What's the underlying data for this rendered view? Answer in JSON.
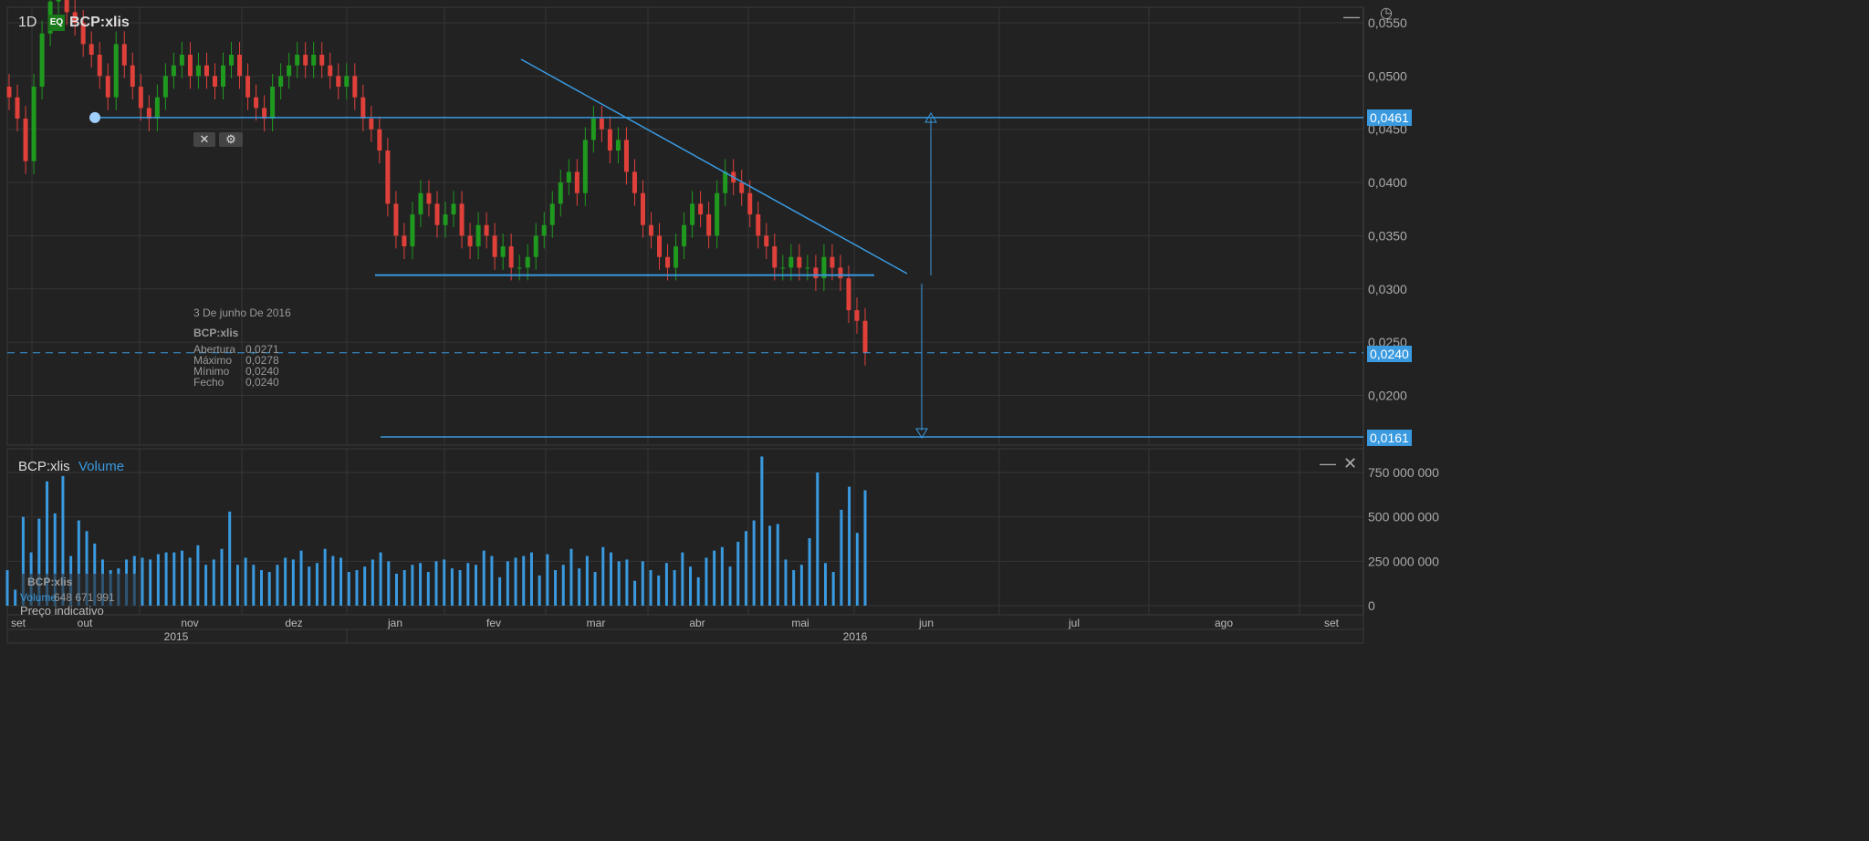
{
  "header": {
    "interval": "1D",
    "badge": "EQ",
    "symbol": "BCP:xlis"
  },
  "price_tags": {
    "resistance": "0,0461",
    "last": "0,0240",
    "target": "0,0161"
  },
  "tooltip": {
    "date": "3 De junho De 2016",
    "symbol": "BCP:xlis",
    "rows": [
      {
        "label": "Abertura",
        "value": "0,0271"
      },
      {
        "label": "Máximo",
        "value": "0,0278"
      },
      {
        "label": "Mínimo",
        "value": "0,0240"
      },
      {
        "label": "Fecho",
        "value": "0,0240"
      }
    ]
  },
  "volume_panel": {
    "symbol": "BCP:xlis",
    "title": "Volume",
    "legend_symbol": "BCP:xlis",
    "legend_label": "Volume",
    "legend_value": "648 671 991",
    "note": "Preço indicativo"
  },
  "colors": {
    "up": "#1f9a1f",
    "down": "#e0403a",
    "volume": "#3a9ae0",
    "line": "#3a9ae0"
  },
  "chart_data": {
    "type": "candlestick",
    "title": "BCP:xlis",
    "price_ticks": [
      "0,0550",
      "0,0500",
      "0,0450",
      "0,0400",
      "0,0350",
      "0,0300",
      "0,0250",
      "0,0200"
    ],
    "price_tick_values": [
      0.055,
      0.05,
      0.045,
      0.04,
      0.035,
      0.03,
      0.025,
      0.02
    ],
    "volume_ticks": [
      "750 000 000",
      "500 000 000",
      "250 000 000",
      "0"
    ],
    "volume_tick_values": [
      750,
      500,
      250,
      0
    ],
    "months": [
      "set",
      "out",
      "nov",
      "dez",
      "jan",
      "fev",
      "mar",
      "abr",
      "mai",
      "jun",
      "jul",
      "ago",
      "set"
    ],
    "years": [
      "2015",
      "2016"
    ],
    "close": [
      0.048,
      0.046,
      0.042,
      0.049,
      0.054,
      0.057,
      0.058,
      0.056,
      0.055,
      0.053,
      0.052,
      0.05,
      0.048,
      0.053,
      0.051,
      0.049,
      0.047,
      0.046,
      0.048,
      0.05,
      0.051,
      0.052,
      0.05,
      0.051,
      0.05,
      0.049,
      0.051,
      0.052,
      0.05,
      0.048,
      0.047,
      0.046,
      0.049,
      0.05,
      0.051,
      0.052,
      0.051,
      0.052,
      0.051,
      0.05,
      0.049,
      0.05,
      0.048,
      0.046,
      0.045,
      0.043,
      0.038,
      0.035,
      0.034,
      0.037,
      0.039,
      0.038,
      0.036,
      0.037,
      0.038,
      0.035,
      0.034,
      0.036,
      0.035,
      0.033,
      0.034,
      0.032,
      0.032,
      0.033,
      0.035,
      0.036,
      0.038,
      0.04,
      0.041,
      0.039,
      0.044,
      0.046,
      0.045,
      0.043,
      0.044,
      0.041,
      0.039,
      0.036,
      0.035,
      0.033,
      0.032,
      0.034,
      0.036,
      0.038,
      0.037,
      0.035,
      0.039,
      0.041,
      0.04,
      0.039,
      0.037,
      0.035,
      0.034,
      0.032,
      0.032,
      0.033,
      0.032,
      0.032,
      0.031,
      0.033,
      0.032,
      0.031,
      0.028,
      0.027,
      0.024
    ],
    "volume_millions": [
      200,
      90,
      500,
      300,
      490,
      700,
      520,
      730,
      280,
      480,
      420,
      350,
      260,
      200,
      210,
      260,
      280,
      270,
      260,
      290,
      300,
      300,
      310,
      270,
      340,
      230,
      260,
      320,
      530,
      230,
      270,
      230,
      200,
      190,
      230,
      270,
      260,
      310,
      220,
      240,
      320,
      280,
      270,
      190,
      200,
      220,
      260,
      300,
      250,
      180,
      200,
      230,
      240,
      190,
      250,
      260,
      210,
      200,
      240,
      230,
      310,
      280,
      160,
      250,
      270,
      280,
      300,
      170,
      290,
      200,
      230,
      320,
      210,
      280,
      190,
      330,
      300,
      250,
      260,
      140,
      250,
      200,
      170,
      240,
      200,
      300,
      220,
      160,
      270,
      310,
      330,
      220,
      360,
      420,
      480,
      840,
      450,
      460,
      260,
      200,
      230,
      380,
      750,
      240,
      190,
      540,
      670,
      410,
      650
    ],
    "reference_lines": {
      "resistance": 0.0461,
      "support": 0.0313,
      "last": 0.024,
      "target": 0.0161
    }
  }
}
